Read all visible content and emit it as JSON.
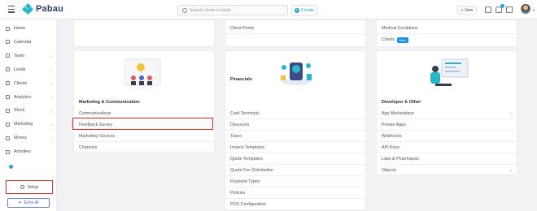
{
  "header": {
    "brand": "Pabau",
    "search_placeholder": "Search clients or leads",
    "create_label": "Create",
    "view_label": "+ View",
    "notification_count": "21"
  },
  "sidebar": {
    "items": [
      {
        "label": "Home",
        "chevron": false
      },
      {
        "label": "Calendar",
        "chevron": false
      },
      {
        "label": "Team",
        "chevron": true
      },
      {
        "label": "Leads",
        "chevron": true
      },
      {
        "label": "Clients",
        "chevron": true
      },
      {
        "label": "Analytics",
        "chevron": true
      },
      {
        "label": "Stock",
        "chevron": true
      },
      {
        "label": "Marketing",
        "chevron": true
      },
      {
        "label": "Money",
        "chevron": true
      },
      {
        "label": "Activities",
        "chevron": false
      }
    ],
    "setup_label": "Setup",
    "echo_label": "Echo AI"
  },
  "cards_top": {
    "middle": [
      "Client Portal"
    ],
    "right": [
      "Medical Conditions",
      "Charts"
    ],
    "new_badge": "New"
  },
  "sections": {
    "marketing": {
      "title": "Marketing & Communication",
      "items": [
        "Communications",
        "Feedback Survey",
        "Marketing Sources",
        "Channels"
      ]
    },
    "financials": {
      "title": "Financials",
      "items": [
        "Card Terminals",
        "Discounts",
        "Taxes",
        "Invoice Templates",
        "Quote Templates",
        "Quote Fee Distribution",
        "Payment Types",
        "Policies",
        "POS Configuration"
      ]
    },
    "developer": {
      "title": "Developer & Other",
      "items": [
        "App Marketplace",
        "Private Apps",
        "Webhooks",
        "API Keys",
        "Labs & Pharmacies",
        "Objects"
      ]
    }
  },
  "colors": {
    "accent": "#2aa7c0",
    "highlight": "#d9342b",
    "echo": "#4b5fb8"
  }
}
